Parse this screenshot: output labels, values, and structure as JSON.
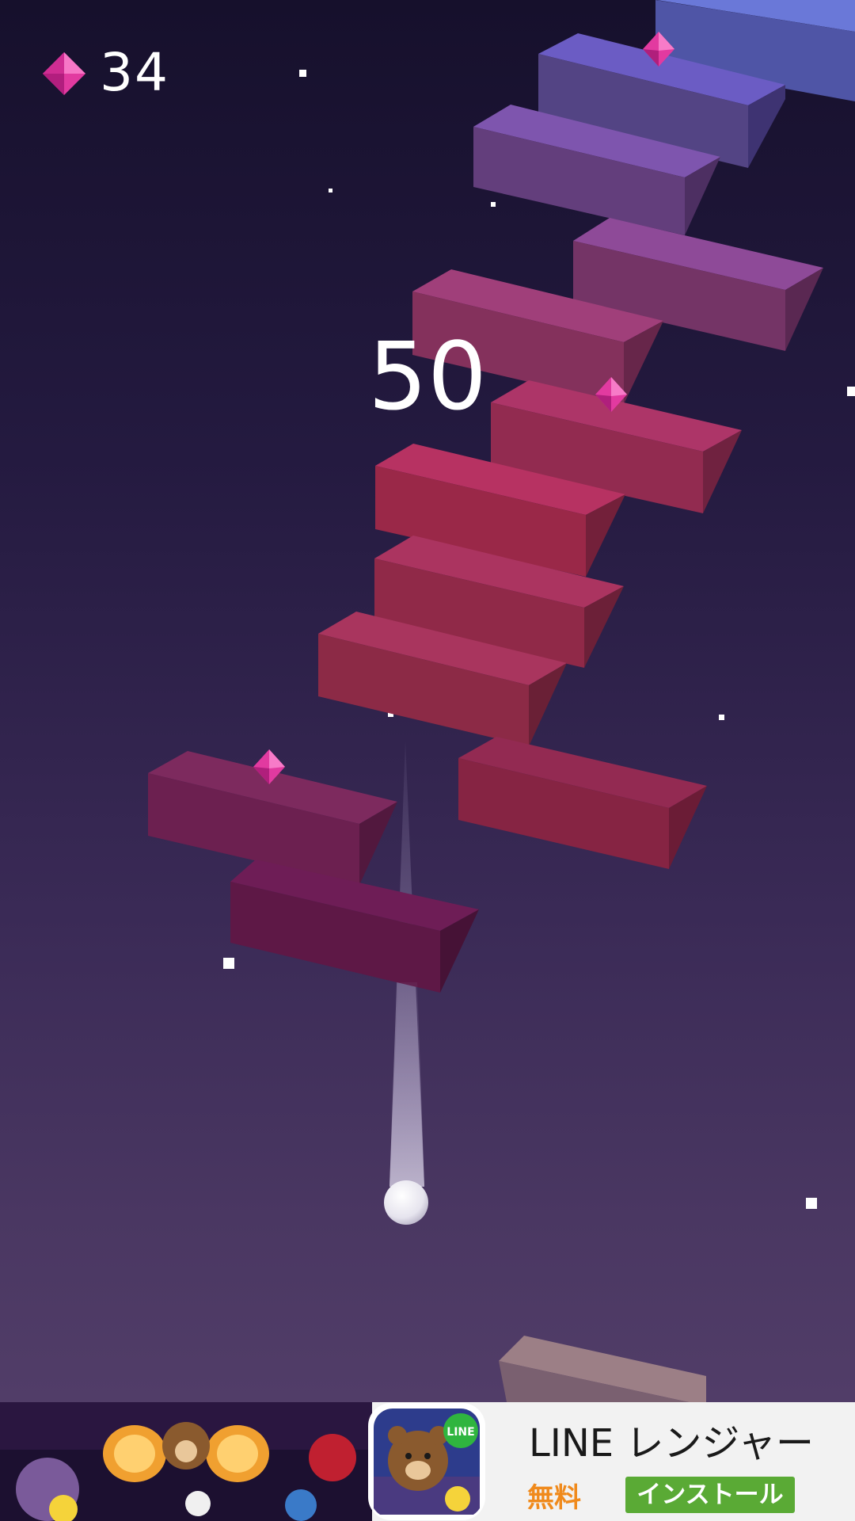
{
  "hud": {
    "gem_icon": "pink-diamond-gem",
    "gem_count": "34"
  },
  "score": "50",
  "colors": {
    "gem": "#e23aa0",
    "ball": "#f2f2f6",
    "install_button": "#5aaa35",
    "price_text": "#f08a1c"
  },
  "ad": {
    "app_icon": "line-rangers-app-icon",
    "badge": "LINE",
    "title": "LINE レンジャー",
    "price": "無料",
    "install_label": "インストール"
  }
}
